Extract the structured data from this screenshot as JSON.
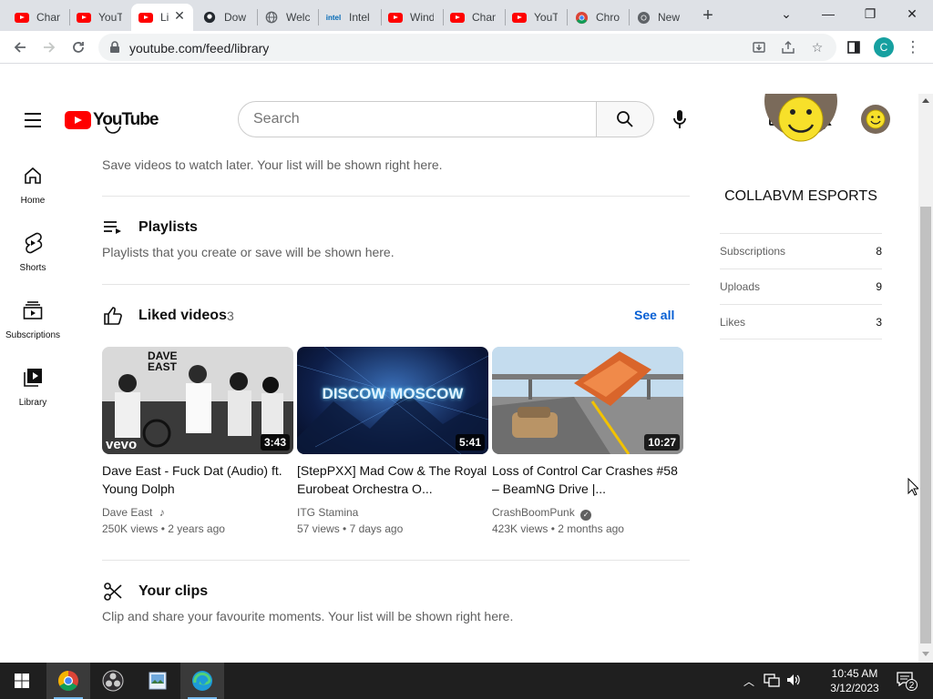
{
  "browser": {
    "tabs": [
      {
        "title": "Chan",
        "icon": "youtube-icon"
      },
      {
        "title": "YouT",
        "icon": "youtube-icon"
      },
      {
        "title": "Li",
        "icon": "youtube-icon",
        "active": true
      },
      {
        "title": "Dow",
        "icon": "github-icon"
      },
      {
        "title": "Welc",
        "icon": "globe-icon"
      },
      {
        "title": "Intel",
        "icon": "intel-icon"
      },
      {
        "title": "Wind",
        "icon": "youtube-icon"
      },
      {
        "title": "Chan",
        "icon": "youtube-icon"
      },
      {
        "title": "YouT",
        "icon": "youtube-icon"
      },
      {
        "title": "Chro",
        "icon": "chrome-icon"
      },
      {
        "title": "New",
        "icon": "chrome-icon"
      }
    ],
    "url": "youtube.com/feed/library",
    "profile_initial": "C"
  },
  "masthead": {
    "logo_text": "YouTube",
    "search_placeholder": "Search"
  },
  "guide": [
    {
      "label": "Home",
      "icon": "home-icon"
    },
    {
      "label": "Shorts",
      "icon": "shorts-icon"
    },
    {
      "label": "Subscriptions",
      "icon": "subscriptions-icon"
    },
    {
      "label": "Library",
      "icon": "library-icon"
    }
  ],
  "library": {
    "watch_later_text": "Save videos to watch later. Your list will be shown right here.",
    "playlists": {
      "title": "Playlists",
      "text": "Playlists that you create or save will be shown here."
    },
    "liked": {
      "title": "Liked videos",
      "count": "3",
      "see_all": "See all",
      "videos": [
        {
          "title": "Dave East - Fuck Dat (Audio) ft. Young Dolph",
          "channel": "Dave East",
          "views": "250K views",
          "age": "2 years ago",
          "duration": "3:43",
          "thumb_text": "DAVE EAST",
          "badge": "vevo"
        },
        {
          "title": "[StepPXX] Mad Cow & The Royal Eurobeat Orchestra O...",
          "channel": "ITG Stamina",
          "views": "57 views",
          "age": "7 days ago",
          "duration": "5:41",
          "thumb_text": "DISCOW MOSCOW"
        },
        {
          "title": "Loss of Control Car Crashes #58 – BeamNG Drive |...",
          "channel": "CrashBoomPunk",
          "views": "423K views",
          "age": "2 months ago",
          "duration": "10:27"
        }
      ]
    },
    "clips": {
      "title": "Your clips",
      "text": "Clip and share your favourite moments. Your list will be shown right here."
    }
  },
  "channel_card": {
    "name": "COLLABVM ESPORTS",
    "stats": [
      {
        "label": "Subscriptions",
        "value": "8"
      },
      {
        "label": "Uploads",
        "value": "9"
      },
      {
        "label": "Likes",
        "value": "3"
      }
    ]
  },
  "taskbar": {
    "time": "10:45 AM",
    "date": "3/12/2023",
    "notification_count": "2"
  },
  "colors": {
    "youtube_red": "#ff0000",
    "link_blue": "#065fd4"
  }
}
